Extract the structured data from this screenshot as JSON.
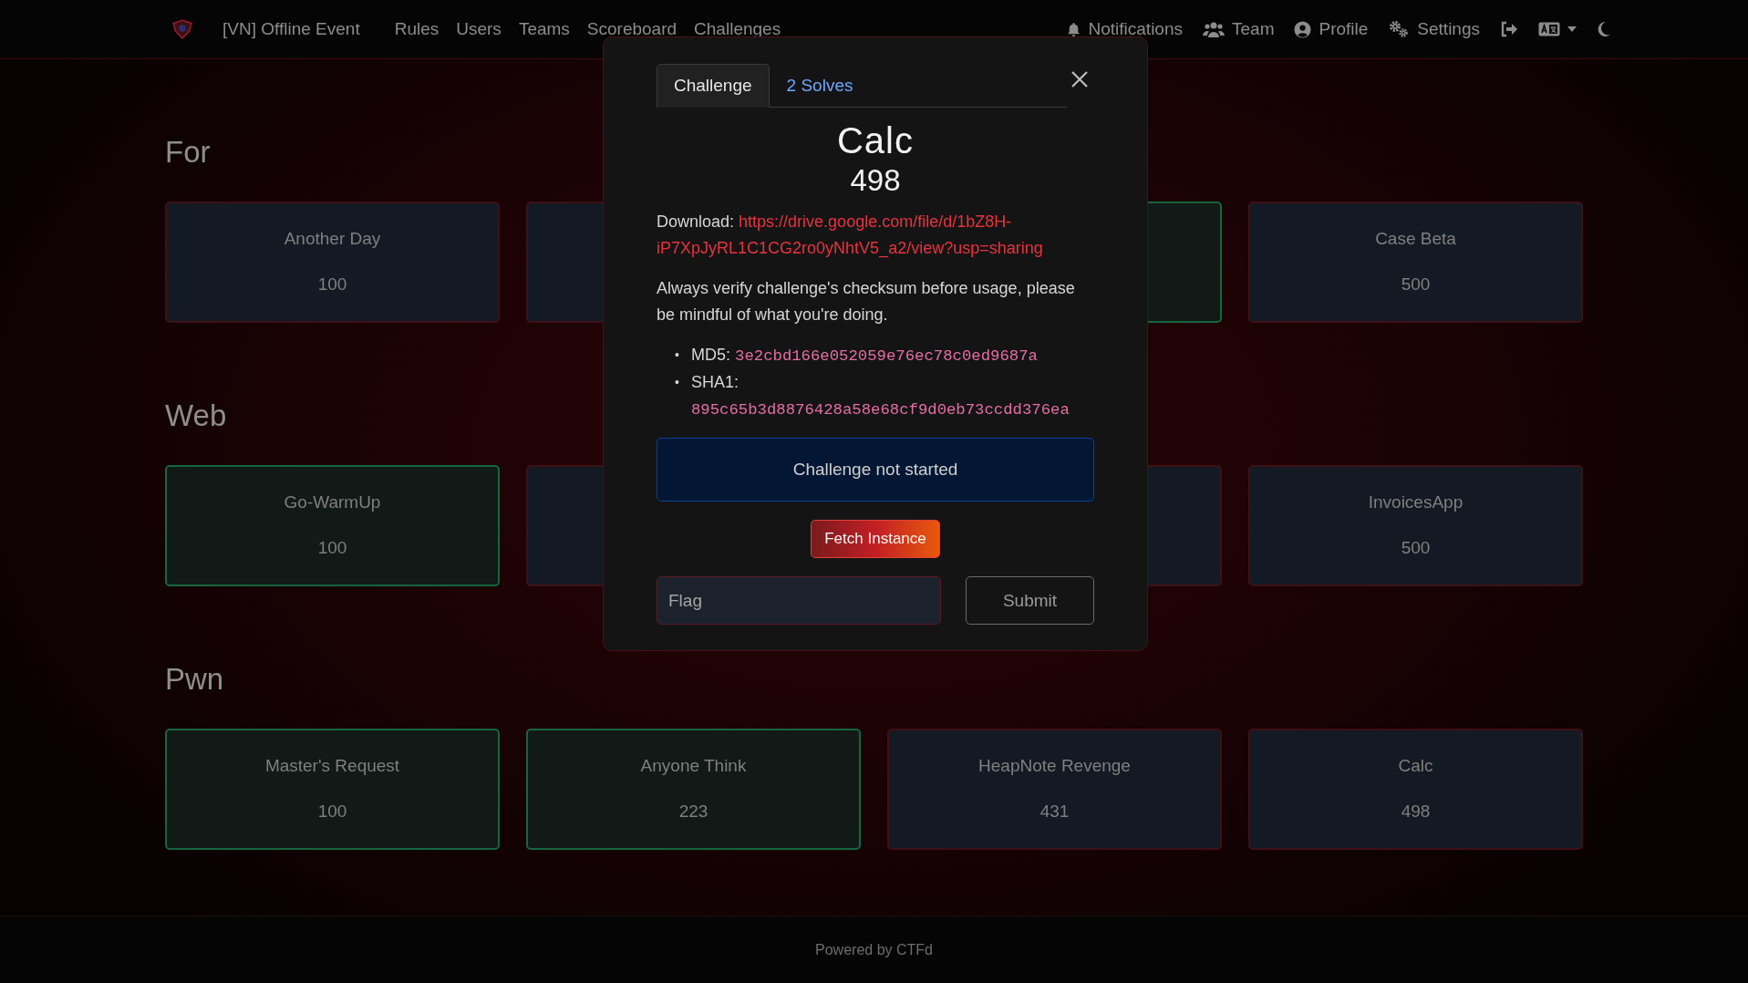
{
  "navbar": {
    "brand": "[VN] Offline Event",
    "links": [
      {
        "label": "Rules"
      },
      {
        "label": "Users"
      },
      {
        "label": "Teams"
      },
      {
        "label": "Scoreboard"
      },
      {
        "label": "Challenges"
      }
    ],
    "right": [
      {
        "kind": "notifications",
        "label": "Notifications"
      },
      {
        "kind": "team",
        "label": "Team"
      },
      {
        "kind": "profile",
        "label": "Profile"
      },
      {
        "kind": "settings",
        "label": "Settings"
      },
      {
        "kind": "logout"
      },
      {
        "kind": "language"
      },
      {
        "kind": "theme"
      }
    ]
  },
  "categories": [
    {
      "name": "For",
      "challenges": [
        {
          "name": "Another Day",
          "value": "100",
          "solved": false
        },
        {
          "solved": false
        },
        {
          "solved": true
        },
        {
          "name": "Case Beta",
          "value": "500",
          "solved": false
        }
      ]
    },
    {
      "name": "Web",
      "challenges": [
        {
          "name": "Go-WarmUp",
          "value": "100",
          "solved": true
        },
        {
          "solved": false
        },
        {
          "solved": false
        },
        {
          "name": "InvoicesApp",
          "value": "500",
          "solved": false
        }
      ]
    },
    {
      "name": "Pwn",
      "challenges": [
        {
          "name": "Master's Request",
          "value": "100",
          "solved": true
        },
        {
          "name": "Anyone Think",
          "value": "223",
          "solved": true
        },
        {
          "name": "HeapNote Revenge",
          "value": "431",
          "solved": false
        },
        {
          "name": "Calc",
          "value": "498",
          "solved": false
        }
      ]
    }
  ],
  "modal": {
    "tabs": [
      {
        "label": "Challenge",
        "selected": true
      },
      {
        "label": "2 Solves",
        "selected": false
      }
    ],
    "name": "Calc",
    "value": "498",
    "download_label": "Download:",
    "download_url": "https://drive.google.com/file/d/1bZ8H-iP7XpJyRL1C1CG2ro0yNhtV5_a2/view?usp=sharing",
    "description": "Always verify challenge's checksum before usage, please be mindful of what you're doing.",
    "hashes": [
      {
        "marker": "•",
        "label": "MD5:",
        "value": "3e2cbd166e052059e76ec78c0ed9687a"
      },
      {
        "marker": "•",
        "label": "SHA1:",
        "value": "895c65b3d8876428a58e68cf9d0eb73ccdd376ea"
      }
    ],
    "status": "Challenge not started",
    "fetch_button": "Fetch Instance",
    "flag": {
      "placeholder": "Flag"
    },
    "submit": "Submit"
  },
  "footer": "Powered by CTFd"
}
